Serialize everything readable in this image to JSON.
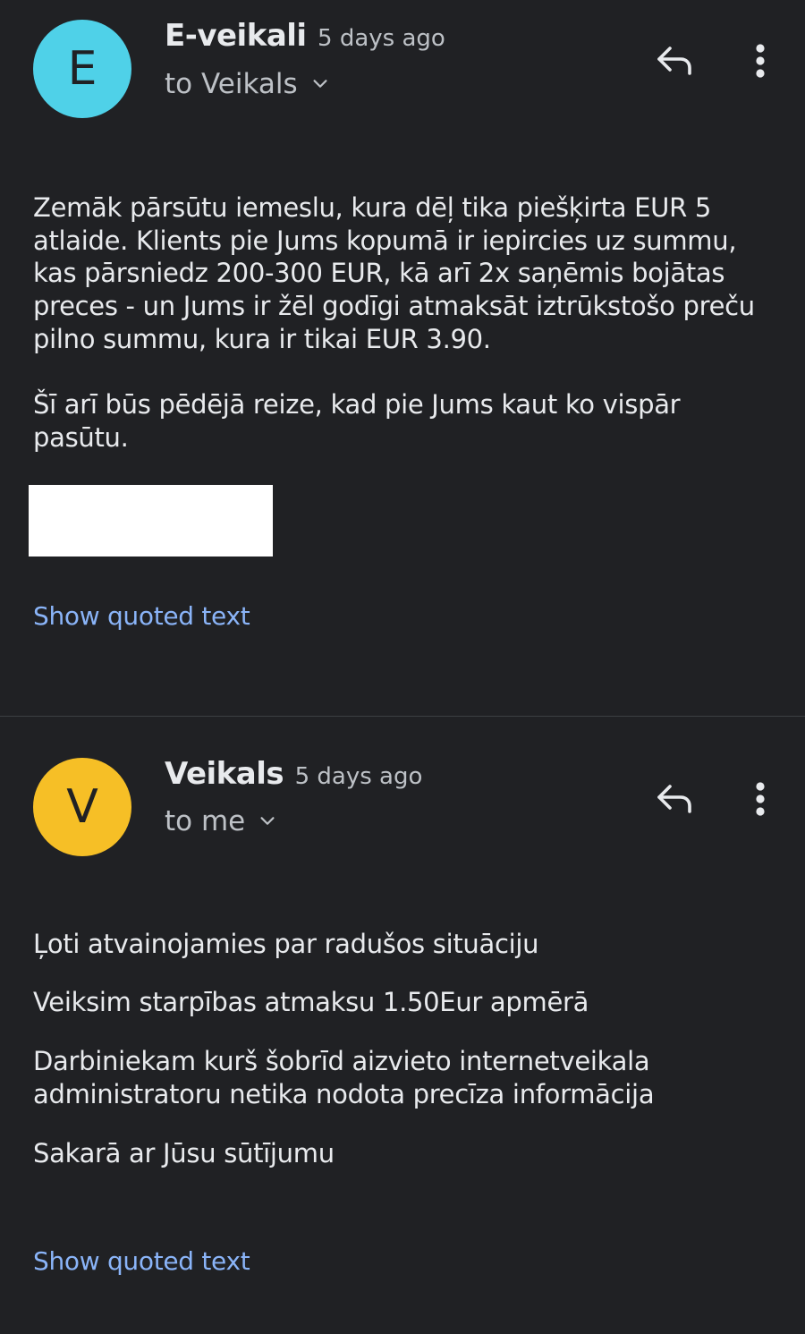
{
  "colors": {
    "background": "#202124",
    "divider": "#3c4043",
    "text": "#e8eaed",
    "secondary_text": "#bdc1c6",
    "link": "#8ab4f8",
    "avatar_e": "#4fd1e8",
    "avatar_v": "#f6bf26"
  },
  "messages": [
    {
      "avatar_letter": "E",
      "sender": "E-veikali",
      "timestamp": "5 days ago",
      "recipient": "to Veikals",
      "body": [
        "Zemāk pārsūtu iemeslu, kura dēļ tika piešķirta EUR 5 atlaide. Klients pie Jums kopumā ir iepircies uz summu, kas pārsniedz 200-300 EUR, kā arī 2x saņēmis bojātas preces - un Jums ir žēl godīgi atmaksāt iztrūkstošo preču pilno summu, kura ir tikai EUR 3.90.",
        "Šī arī būs pēdējā reize, kad pie Jums kaut ko vispār pasūtu."
      ],
      "show_quoted": "Show quoted text",
      "icons": {
        "reply": "reply-icon",
        "more": "more-vert-icon",
        "chevron": "chevron-down-icon"
      }
    },
    {
      "avatar_letter": "V",
      "sender": "Veikals",
      "timestamp": "5 days ago",
      "recipient": "to me",
      "body": [
        "Ļoti atvainojamies par radušos situāciju",
        "Veiksim starpības atmaksu 1.50Eur apmērā",
        "Darbiniekam kurš šobrīd aizvieto internetveikala administratoru netika nodota precīza informācija",
        "Sakarā ar Jūsu sūtījumu"
      ],
      "show_quoted": "Show quoted text",
      "icons": {
        "reply": "reply-icon",
        "more": "more-vert-icon",
        "chevron": "chevron-down-icon"
      }
    }
  ]
}
